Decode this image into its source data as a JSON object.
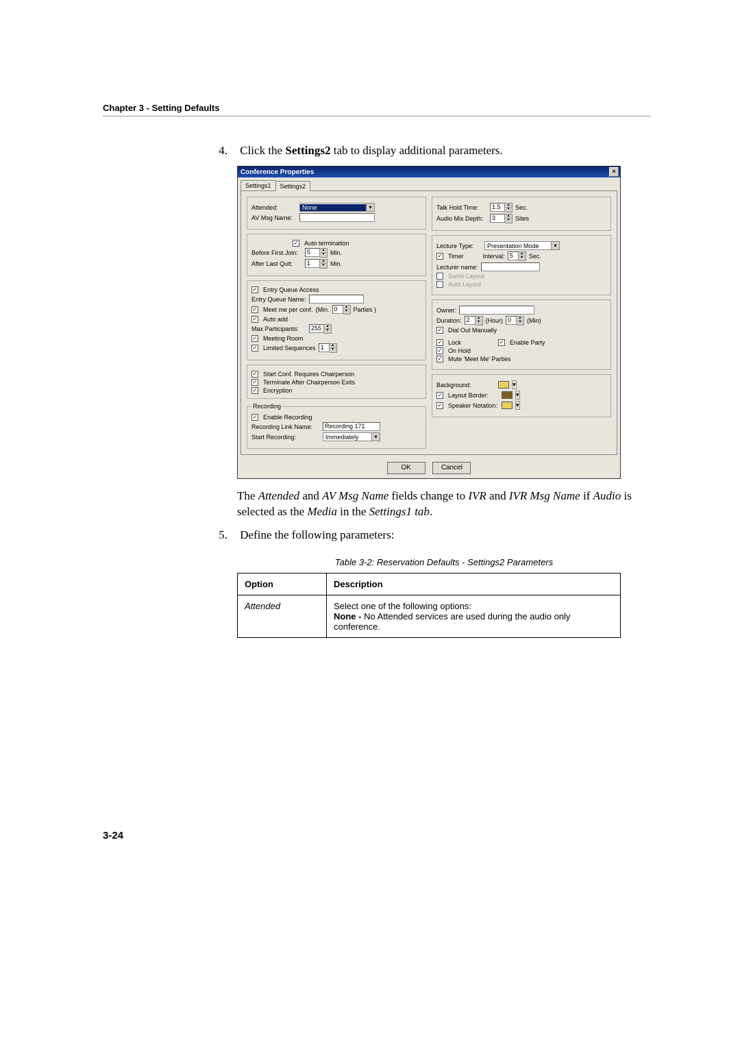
{
  "chapter_header": "Chapter 3 - Setting Defaults",
  "steps": {
    "s4num": "4.",
    "s4a": "Click the ",
    "s4b": "Settings2",
    "s4c": " tab to display additional parameters.",
    "s5num": "5.",
    "s5": " Define the following parameters:"
  },
  "note": {
    "a": "The ",
    "b": "Attended",
    "c": " and ",
    "d": "AV Msg Name",
    "e": " fields change to ",
    "f": "IVR",
    "g": " and ",
    "h": "IVR Msg Name",
    "i": " if ",
    "j": "Audio",
    "k": " is selected as the ",
    "l": "Media",
    "m": " in the ",
    "n": "Settings1 tab",
    "o": "."
  },
  "table_caption": "Table 3-2: Reservation Defaults - Settings2 Parameters",
  "table": {
    "h1": "Option",
    "h2": "Description",
    "r1c1": "Attended",
    "r1c2a": "Select one of the following options:",
    "r1c2b": "None -",
    "r1c2c": " No Attended services are used during the audio only conference."
  },
  "page_number": "3-24",
  "dlg": {
    "title": "Conference Properties",
    "close": "×",
    "tab1": "Settings1",
    "tab2": "Settings2",
    "attended_lbl": "Attended:",
    "attended_val": "None",
    "avmsg_lbl": "AV Msg Name:",
    "auto_term": "Auto termination",
    "before_lbl": "Before First Join:",
    "before_v": "5",
    "min": "Min.",
    "after_lbl": "After Last Quit:",
    "after_v": "1",
    "talk_lbl": "Talk Hold Time:",
    "talk_v": "1.5",
    "sec": "Sec.",
    "mix_lbl": "Audio Mix Depth:",
    "mix_v": "3",
    "sites": "Sites",
    "lect_type_lbl": "Lecture Type:",
    "lect_type_v": "Presentation Mode",
    "timer": "Timer",
    "interval_lbl": "Interval:",
    "interval_v": "5",
    "lect_name_lbl": "Lecturer name:",
    "same_layout": "Same Layout",
    "auto_layout": "Auto Layout",
    "eq_access": "Entry Queue Access",
    "eq_name_lbl": "Entry Queue Name:",
    "meetme_conf": "Meet me per conf.",
    "minp": "(Min.",
    "minp_v": "0",
    "parties": "Parties )",
    "auto_add": "Auto add",
    "maxp_lbl": "Max Participants:",
    "maxp_v": "255",
    "meeting_room": "Meeting Room",
    "lim_seq": "Limited Sequences",
    "lim_v": "1",
    "owner_lbl": "Owner:",
    "dur_lbl": "Duration:",
    "dur_h": "2",
    "hour": "(Hour)",
    "dur_m": "0",
    "minlbl": "(Min)",
    "dial_out": "Dial Out Manually",
    "lock": "Lock",
    "enable_party": "Enable Party",
    "onhold": "On Hold",
    "mute_mm": "Mute 'Meet Me' Parties",
    "start_chair": "Start Conf. Requires Chairperson",
    "term_chair": "Terminate After Chairperson Exits",
    "encryption": "Encryption",
    "rec_legend": "Recording",
    "enable_rec": "Enable Recording",
    "rec_link_lbl": "Recording Link Name:",
    "rec_link_v": "Recording 171",
    "start_rec_lbl": "Start Recording:",
    "start_rec_v": "Immediately",
    "bg_lbl": "Background:",
    "lay_border": "Layout Border:",
    "spk_not": "Speaker Notation:",
    "ok": "OK",
    "cancel": "Cancel"
  }
}
